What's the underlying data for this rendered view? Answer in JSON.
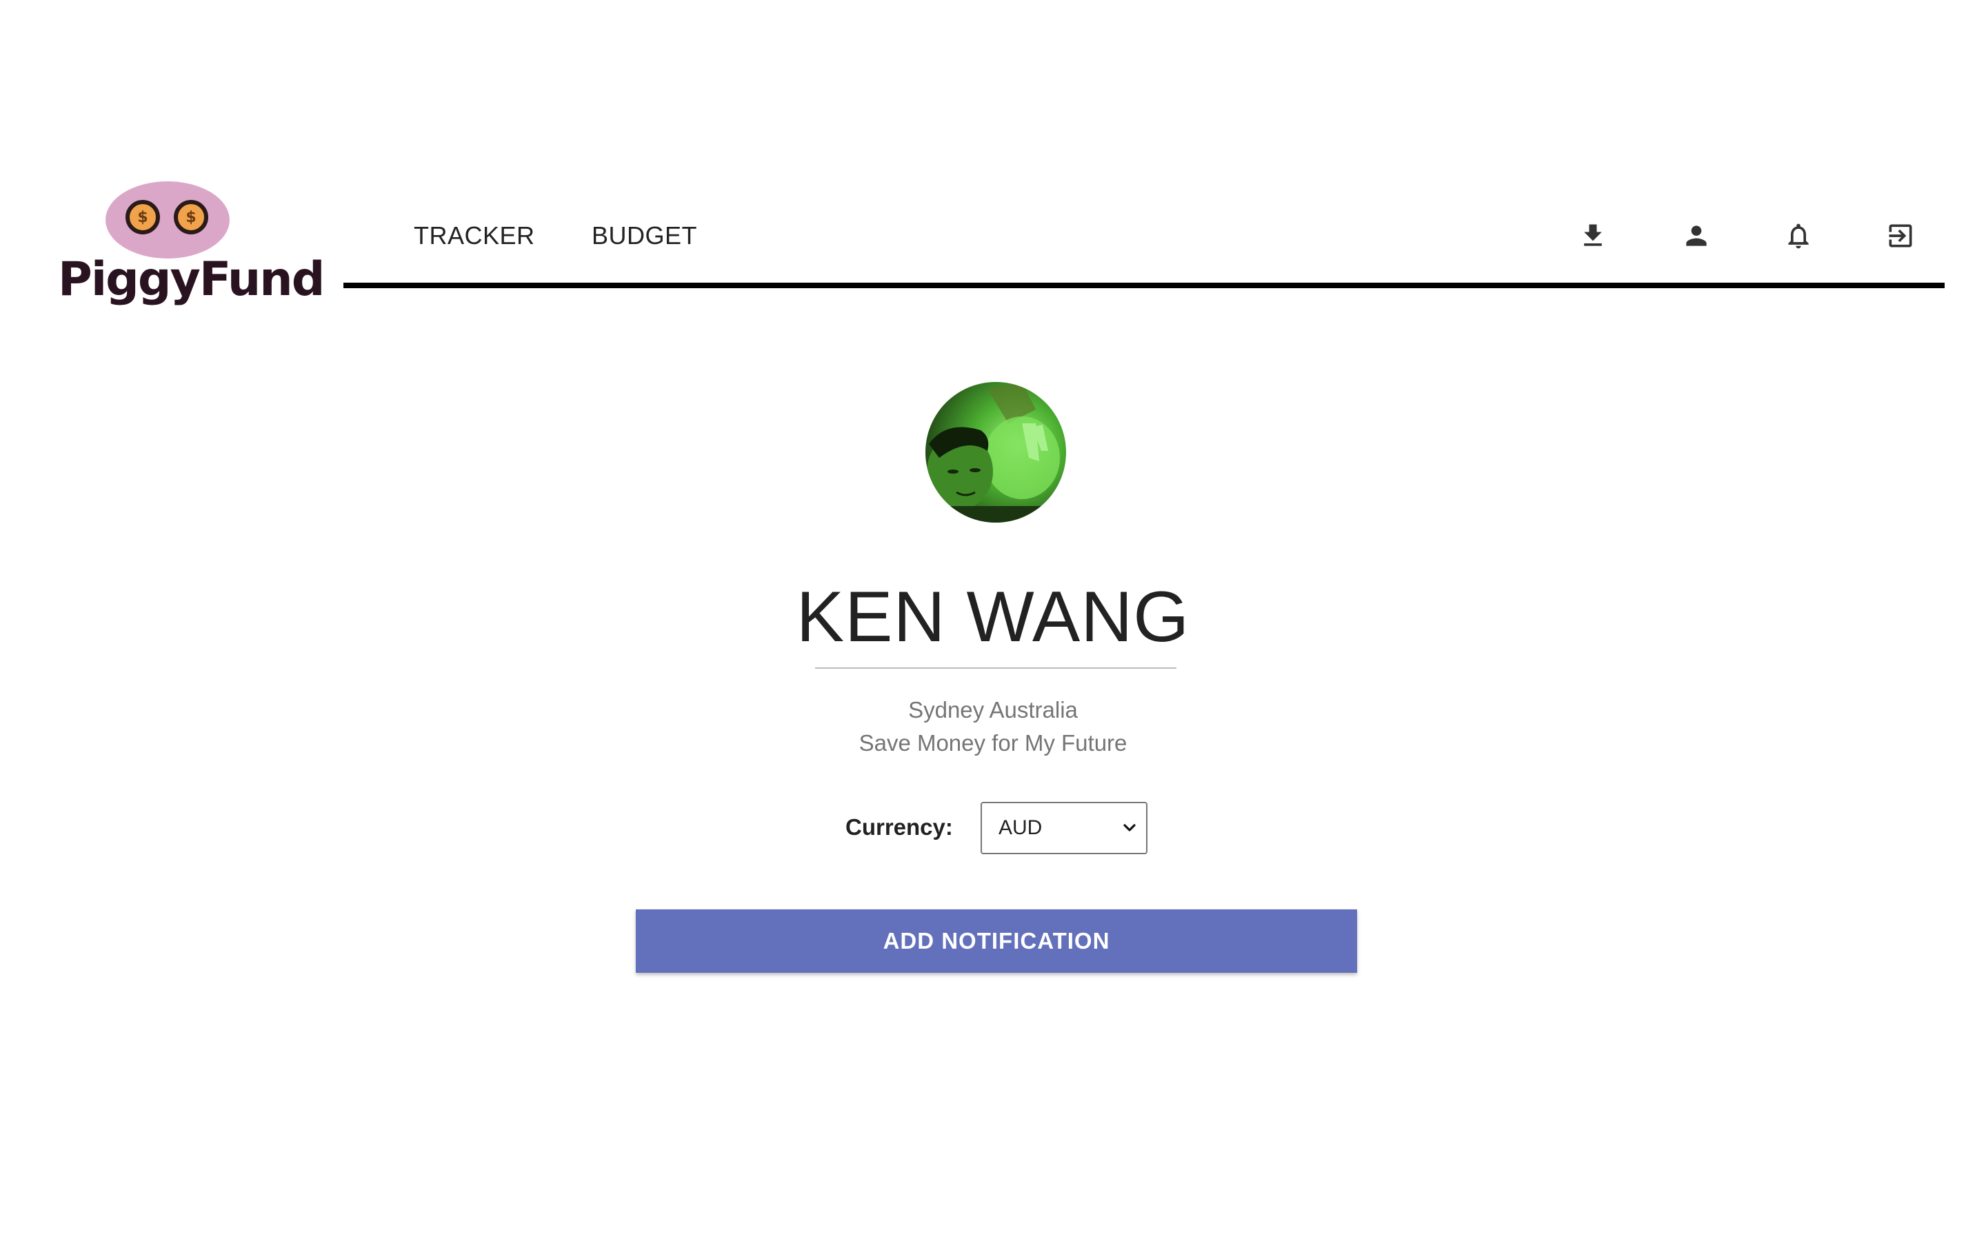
{
  "brand": {
    "name": "PiggyFund",
    "coin_symbol": "$",
    "pig_color": "#dba7c8"
  },
  "nav": {
    "links": [
      {
        "label": "TRACKER",
        "icon": null
      },
      {
        "label": "BUDGET",
        "icon": null
      }
    ],
    "icons": [
      "download-icon",
      "person-icon",
      "bell-icon",
      "logout-icon"
    ]
  },
  "profile": {
    "name": "KEN WANG",
    "location": "Sydney Australia",
    "motto": "Save Money for My Future"
  },
  "currency": {
    "label": "Currency:",
    "selected": "AUD"
  },
  "actions": {
    "add_notification_label": "ADD NOTIFICATION",
    "button_color": "#6370bb"
  }
}
